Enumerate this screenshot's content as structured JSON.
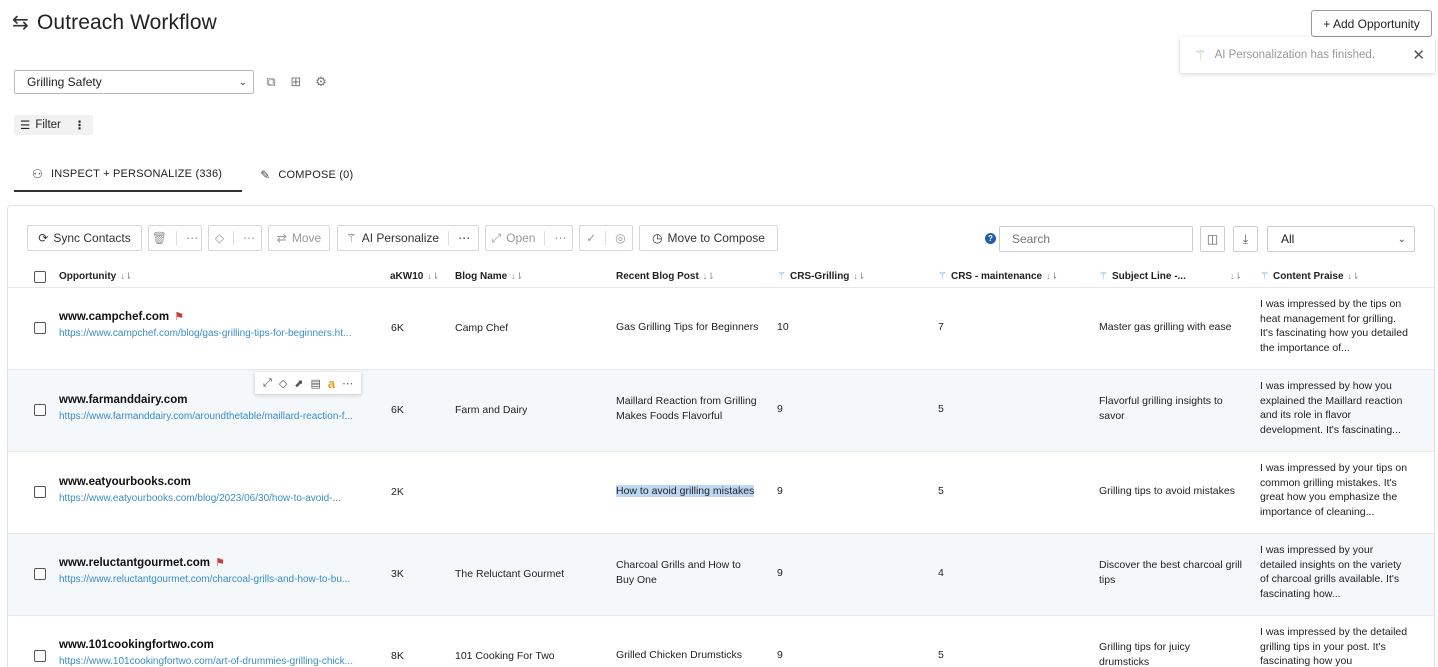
{
  "header": {
    "title": "Outreach Workflow",
    "add_button_label": "+ Add Opportunity"
  },
  "toast": {
    "message": "AI Personalization has finished.",
    "close": "✕"
  },
  "campaign_select": {
    "value": "Grilling Safety"
  },
  "filter": {
    "label": "Filter"
  },
  "tabs": [
    {
      "label": "INSPECT + PERSONALIZE (336)"
    },
    {
      "label": "COMPOSE (0)"
    }
  ],
  "toolbar": {
    "sync_contacts": "Sync Contacts",
    "move": "Move",
    "ai_personalize": "AI Personalize",
    "open": "Open",
    "move_to_compose": "Move to Compose",
    "search_placeholder": "Search",
    "view_filter": "All"
  },
  "columns": {
    "opportunity": "Opportunity",
    "akw10": "aKW10",
    "blog_name": "Blog Name",
    "recent_post": "Recent Blog Post",
    "crs_grilling": "CRS-Grilling",
    "crs_maintenance": "CRS - maintenance",
    "subject_line": "Subject Line -...",
    "content_praise": "Content Praise"
  },
  "rows": [
    {
      "domain": "www.campchef.com",
      "flagged": true,
      "url": "https://www.campchef.com/blog/gas-grilling-tips-for-beginners.ht...",
      "akw10": "6K",
      "blog_name": "Camp Chef",
      "recent_post": "Gas Grilling Tips for Beginners",
      "crs_grilling": "10",
      "crs_maintenance": "7",
      "subject_line": "Master gas grilling with ease",
      "content_praise": "I was impressed by the tips on heat management for grilling. It's fascinating how you detailed the importance of..."
    },
    {
      "domain": "www.farmanddairy.com",
      "flagged": false,
      "url": "https://www.farmanddairy.com/aroundthetable/maillard-reaction-f...",
      "akw10": "6K",
      "blog_name": "Farm and Dairy",
      "recent_post": "Maillard Reaction from Grilling Makes Foods Flavorful",
      "crs_grilling": "9",
      "crs_maintenance": "5",
      "subject_line": "Flavorful grilling insights to savor",
      "content_praise": "I was impressed by how you explained the Maillard reaction and its role in flavor development. It's fascinating..."
    },
    {
      "domain": "www.eatyourbooks.com",
      "flagged": false,
      "url": "https://www.eatyourbooks.com/blog/2023/06/30/how-to-avoid-...",
      "akw10": "2K",
      "blog_name": "",
      "recent_post": "How to avoid grilling mistakes",
      "crs_grilling": "9",
      "crs_maintenance": "5",
      "subject_line": "Grilling tips to avoid mistakes",
      "content_praise": "I was impressed by your tips on common grilling mistakes. It's great how you emphasize the importance of cleaning..."
    },
    {
      "domain": "www.reluctantgourmet.com",
      "flagged": true,
      "url": "https://www.reluctantgourmet.com/charcoal-grills-and-how-to-bu...",
      "akw10": "3K",
      "blog_name": "The Reluctant Gourmet",
      "recent_post": "Charcoal Grills and How to Buy One",
      "crs_grilling": "9",
      "crs_maintenance": "4",
      "subject_line": "Discover the best charcoal grill tips",
      "content_praise": "I was impressed by your detailed insights on the variety of charcoal grills available. It's fascinating how..."
    },
    {
      "domain": "www.101cookingfortwo.com",
      "flagged": false,
      "url": "https://www.101cookingfortwo.com/art-of-drummies-grilling-chick...",
      "akw10": "8K",
      "blog_name": "101 Cooking For Two",
      "recent_post": "Grilled Chicken Drumsticks",
      "crs_grilling": "9",
      "crs_maintenance": "5",
      "subject_line": "Grilling tips for juicy drumsticks",
      "content_praise": "I was impressed by the detailed grilling tips in your post. It's fascinating how you"
    }
  ],
  "colors": {
    "link": "#3a8dc6",
    "flag": "#c8403a",
    "highlight": "#bcd8f3",
    "row_alt": "#f5f8fb",
    "help": "#1f5fa8"
  }
}
